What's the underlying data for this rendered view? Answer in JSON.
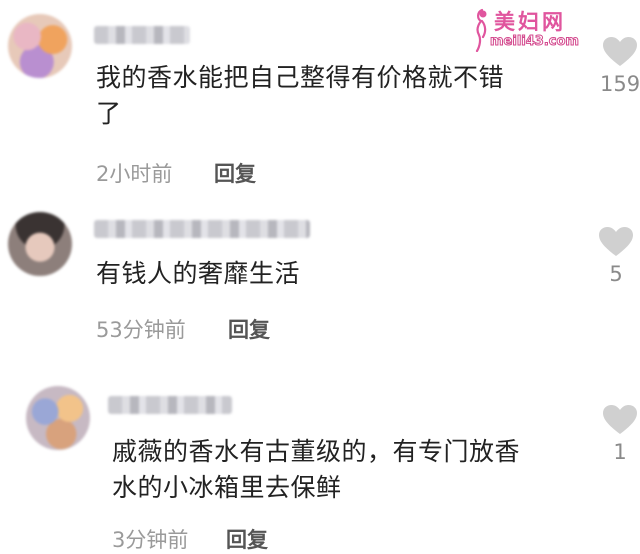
{
  "watermark": {
    "title": "美妇网",
    "url": "meili43.com"
  },
  "comments": [
    {
      "text_lines": [
        "我的香水能把自己整得有价格就不错",
        "了"
      ],
      "time": "2小时前",
      "reply_label": "回复",
      "likes": "159"
    },
    {
      "text_lines": [
        "有钱人的奢靡生活"
      ],
      "time": "53分钟前",
      "reply_label": "回复",
      "likes": "5"
    },
    {
      "text_lines": [
        "戚薇的香水有古董级的，有专门放香",
        "水的小冰箱里去保鲜"
      ],
      "time": "3分钟前",
      "reply_label": "回复",
      "likes": "1"
    }
  ],
  "colors": {
    "heart": "#d0d0d0",
    "watermark": "#e0559e"
  }
}
